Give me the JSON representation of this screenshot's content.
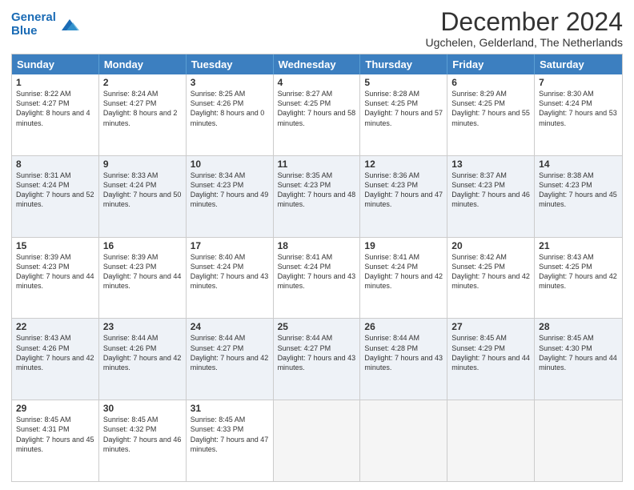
{
  "logo": {
    "line1": "General",
    "line2": "Blue"
  },
  "title": "December 2024",
  "subtitle": "Ugchelen, Gelderland, The Netherlands",
  "header_days": [
    "Sunday",
    "Monday",
    "Tuesday",
    "Wednesday",
    "Thursday",
    "Friday",
    "Saturday"
  ],
  "weeks": [
    [
      {
        "day": "1",
        "sunrise": "Sunrise: 8:22 AM",
        "sunset": "Sunset: 4:27 PM",
        "daylight": "Daylight: 8 hours and 4 minutes."
      },
      {
        "day": "2",
        "sunrise": "Sunrise: 8:24 AM",
        "sunset": "Sunset: 4:27 PM",
        "daylight": "Daylight: 8 hours and 2 minutes."
      },
      {
        "day": "3",
        "sunrise": "Sunrise: 8:25 AM",
        "sunset": "Sunset: 4:26 PM",
        "daylight": "Daylight: 8 hours and 0 minutes."
      },
      {
        "day": "4",
        "sunrise": "Sunrise: 8:27 AM",
        "sunset": "Sunset: 4:25 PM",
        "daylight": "Daylight: 7 hours and 58 minutes."
      },
      {
        "day": "5",
        "sunrise": "Sunrise: 8:28 AM",
        "sunset": "Sunset: 4:25 PM",
        "daylight": "Daylight: 7 hours and 57 minutes."
      },
      {
        "day": "6",
        "sunrise": "Sunrise: 8:29 AM",
        "sunset": "Sunset: 4:25 PM",
        "daylight": "Daylight: 7 hours and 55 minutes."
      },
      {
        "day": "7",
        "sunrise": "Sunrise: 8:30 AM",
        "sunset": "Sunset: 4:24 PM",
        "daylight": "Daylight: 7 hours and 53 minutes."
      }
    ],
    [
      {
        "day": "8",
        "sunrise": "Sunrise: 8:31 AM",
        "sunset": "Sunset: 4:24 PM",
        "daylight": "Daylight: 7 hours and 52 minutes."
      },
      {
        "day": "9",
        "sunrise": "Sunrise: 8:33 AM",
        "sunset": "Sunset: 4:24 PM",
        "daylight": "Daylight: 7 hours and 50 minutes."
      },
      {
        "day": "10",
        "sunrise": "Sunrise: 8:34 AM",
        "sunset": "Sunset: 4:23 PM",
        "daylight": "Daylight: 7 hours and 49 minutes."
      },
      {
        "day": "11",
        "sunrise": "Sunrise: 8:35 AM",
        "sunset": "Sunset: 4:23 PM",
        "daylight": "Daylight: 7 hours and 48 minutes."
      },
      {
        "day": "12",
        "sunrise": "Sunrise: 8:36 AM",
        "sunset": "Sunset: 4:23 PM",
        "daylight": "Daylight: 7 hours and 47 minutes."
      },
      {
        "day": "13",
        "sunrise": "Sunrise: 8:37 AM",
        "sunset": "Sunset: 4:23 PM",
        "daylight": "Daylight: 7 hours and 46 minutes."
      },
      {
        "day": "14",
        "sunrise": "Sunrise: 8:38 AM",
        "sunset": "Sunset: 4:23 PM",
        "daylight": "Daylight: 7 hours and 45 minutes."
      }
    ],
    [
      {
        "day": "15",
        "sunrise": "Sunrise: 8:39 AM",
        "sunset": "Sunset: 4:23 PM",
        "daylight": "Daylight: 7 hours and 44 minutes."
      },
      {
        "day": "16",
        "sunrise": "Sunrise: 8:39 AM",
        "sunset": "Sunset: 4:23 PM",
        "daylight": "Daylight: 7 hours and 44 minutes."
      },
      {
        "day": "17",
        "sunrise": "Sunrise: 8:40 AM",
        "sunset": "Sunset: 4:24 PM",
        "daylight": "Daylight: 7 hours and 43 minutes."
      },
      {
        "day": "18",
        "sunrise": "Sunrise: 8:41 AM",
        "sunset": "Sunset: 4:24 PM",
        "daylight": "Daylight: 7 hours and 43 minutes."
      },
      {
        "day": "19",
        "sunrise": "Sunrise: 8:41 AM",
        "sunset": "Sunset: 4:24 PM",
        "daylight": "Daylight: 7 hours and 42 minutes."
      },
      {
        "day": "20",
        "sunrise": "Sunrise: 8:42 AM",
        "sunset": "Sunset: 4:25 PM",
        "daylight": "Daylight: 7 hours and 42 minutes."
      },
      {
        "day": "21",
        "sunrise": "Sunrise: 8:43 AM",
        "sunset": "Sunset: 4:25 PM",
        "daylight": "Daylight: 7 hours and 42 minutes."
      }
    ],
    [
      {
        "day": "22",
        "sunrise": "Sunrise: 8:43 AM",
        "sunset": "Sunset: 4:26 PM",
        "daylight": "Daylight: 7 hours and 42 minutes."
      },
      {
        "day": "23",
        "sunrise": "Sunrise: 8:44 AM",
        "sunset": "Sunset: 4:26 PM",
        "daylight": "Daylight: 7 hours and 42 minutes."
      },
      {
        "day": "24",
        "sunrise": "Sunrise: 8:44 AM",
        "sunset": "Sunset: 4:27 PM",
        "daylight": "Daylight: 7 hours and 42 minutes."
      },
      {
        "day": "25",
        "sunrise": "Sunrise: 8:44 AM",
        "sunset": "Sunset: 4:27 PM",
        "daylight": "Daylight: 7 hours and 43 minutes."
      },
      {
        "day": "26",
        "sunrise": "Sunrise: 8:44 AM",
        "sunset": "Sunset: 4:28 PM",
        "daylight": "Daylight: 7 hours and 43 minutes."
      },
      {
        "day": "27",
        "sunrise": "Sunrise: 8:45 AM",
        "sunset": "Sunset: 4:29 PM",
        "daylight": "Daylight: 7 hours and 44 minutes."
      },
      {
        "day": "28",
        "sunrise": "Sunrise: 8:45 AM",
        "sunset": "Sunset: 4:30 PM",
        "daylight": "Daylight: 7 hours and 44 minutes."
      }
    ],
    [
      {
        "day": "29",
        "sunrise": "Sunrise: 8:45 AM",
        "sunset": "Sunset: 4:31 PM",
        "daylight": "Daylight: 7 hours and 45 minutes."
      },
      {
        "day": "30",
        "sunrise": "Sunrise: 8:45 AM",
        "sunset": "Sunset: 4:32 PM",
        "daylight": "Daylight: 7 hours and 46 minutes."
      },
      {
        "day": "31",
        "sunrise": "Sunrise: 8:45 AM",
        "sunset": "Sunset: 4:33 PM",
        "daylight": "Daylight: 7 hours and 47 minutes."
      },
      null,
      null,
      null,
      null
    ]
  ]
}
